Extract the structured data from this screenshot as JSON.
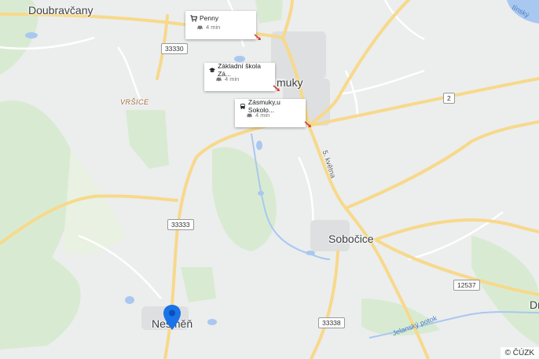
{
  "places": {
    "doubravcany": "Doubravčany",
    "zasmuky": "muky",
    "sobocice": "Sobočice",
    "nesmen": "Nesměň",
    "vrsice": "VRŠICE",
    "dr": "Dr"
  },
  "street_labels": {
    "kvetna": "5. května",
    "jelansky_potok": "Jelanský potok",
    "lake": "tínský"
  },
  "road_shields": {
    "r33330": "33330",
    "r2": "2",
    "r33333": "33333",
    "r12537": "12537",
    "r33338": "33338"
  },
  "pois": [
    {
      "name": "Penny",
      "icon": "shopping-cart-icon",
      "travel": "4 min"
    },
    {
      "name": "Základní škola Zá...",
      "icon": "school-icon",
      "travel": "4 min"
    },
    {
      "name": "Zásmuky,u Sokolo...",
      "icon": "bus-icon",
      "travel": "4 min"
    }
  ],
  "marker": {
    "icon": "location-pin-icon",
    "color": "#1a73e8"
  },
  "attribution": "© ČÚZK",
  "colors": {
    "background": "#eceded",
    "road": "#f7d98b",
    "forest": "#d7ead1",
    "water": "#a9c8f0",
    "route_arrow": "#d23f31"
  }
}
